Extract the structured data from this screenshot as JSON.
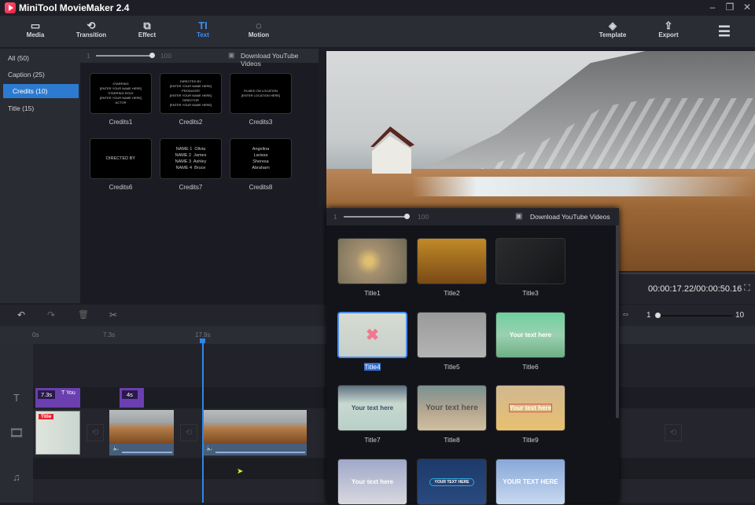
{
  "app": {
    "title": "MiniTool MovieMaker 2.4"
  },
  "toolbar": {
    "items": [
      {
        "label": "Media",
        "icon": "folder-icon"
      },
      {
        "label": "Transition",
        "icon": "transition-icon"
      },
      {
        "label": "Effect",
        "icon": "effect-icon"
      },
      {
        "label": "Text",
        "icon": "text-icon"
      },
      {
        "label": "Motion",
        "icon": "motion-icon"
      }
    ],
    "template": "Template",
    "export": "Export"
  },
  "categories": [
    {
      "label": "All",
      "count": "(50)"
    },
    {
      "label": "Caption",
      "count": "(25)"
    },
    {
      "label": "Credits",
      "count": "(10)"
    },
    {
      "label": "Title",
      "count": "(15)"
    }
  ],
  "library": {
    "slider_min": "1",
    "slider_max": "100",
    "download": "Download YouTube Videos",
    "items": [
      {
        "label": "Credits1",
        "preview": "STARRING\n[ENTER YOUR NAME HERE]\nSTARRING ROLE\n[ENTER YOUR NAME HERE]\nACTOR"
      },
      {
        "label": "Credits2",
        "preview": "DIRECTED BY\n[ENTER YOUR NAME HERE]\nPRODUCER\n[ENTER YOUR NAME HERE]\nDIRECTOR\n[ENTER YOUR NAME HERE]"
      },
      {
        "label": "Credits3",
        "preview": "FILMED ON LOCATION\n[ENTER LOCATION HERE]"
      },
      {
        "label": "Credits6",
        "preview": "DIRECTED BY"
      },
      {
        "label": "Credits7",
        "preview": "NAME 1  Olivia\nNAME 2  James\nNAME 3  Ashley\nNAME 4  Bruce"
      },
      {
        "label": "Credits8",
        "preview": "Angelina\nLarissa\nSheresa\nAbraham"
      }
    ]
  },
  "player": {
    "time": "00:00:17.22/00:00:50.16"
  },
  "timeline": {
    "ruler": [
      "0s",
      "7.3s",
      "17.9s"
    ],
    "text_clips": [
      {
        "duration": "7.3s",
        "label": "You"
      },
      {
        "duration": "4s"
      }
    ],
    "title_clip_badge": "Title",
    "zoom_min": "1",
    "zoom_max": "10"
  },
  "popup": {
    "slider_min": "1",
    "slider_max": "100",
    "download": "Download YouTube Videos",
    "items": [
      {
        "label": "Title1"
      },
      {
        "label": "Title2"
      },
      {
        "label": "Title3"
      },
      {
        "label": "Title4",
        "selected": true
      },
      {
        "label": "Title5"
      },
      {
        "label": "Title6",
        "text": "Your text here"
      },
      {
        "label": "Title7",
        "text": "Your text here"
      },
      {
        "label": "Title8",
        "text": "Your text here"
      },
      {
        "label": "Title9",
        "text": "Your text here"
      },
      {
        "text": "Your text here"
      },
      {
        "text": "YOUR TEXT HERE"
      },
      {
        "text": "YOUR TEXT HERE"
      }
    ]
  },
  "colors": {
    "accent": "#3c8ef0",
    "selected": "#2d7bd0",
    "text_clip": "#6b3fb0",
    "playhead": "#2f86e6"
  }
}
